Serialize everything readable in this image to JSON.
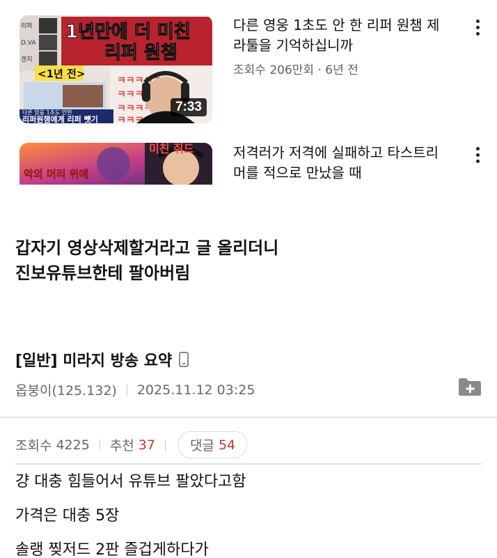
{
  "videos": [
    {
      "title": "다른 영웅 1초도 안 한 리퍼 원챔 제라툴을 기억하십니까",
      "meta": "조회수 206만회 · 6년 전",
      "duration": "7:33",
      "thumb_text_1": "1년만에 더 미친",
      "thumb_text_2": "리퍼 원챔",
      "thumb_text_3": "<1년 전>",
      "thumb_text_4": "다른 영웅 1초도 안한",
      "thumb_text_5": "리퍼원챔에게 리퍼 뺏기",
      "thumb_side_1": "리퍼",
      "thumb_side_2": "D.VA",
      "thumb_side_3": "겐지"
    },
    {
      "title": "저격러가 저격에 실패하고 타스트리머를 적으로 만났을 때",
      "thumb_text_1": "미친 쥐드",
      "thumb_text_2": "악의 머리 위에"
    }
  ],
  "headline": {
    "line1": "갑자기 영상삭제할거라고 글 올리더니",
    "line2": "진보유튜브한테 팔아버림"
  },
  "post": {
    "title": "[일반] 미라지 방송 요약",
    "author": "옵붕이(125.132)",
    "datetime": "2025.11.12 03:25",
    "views_label": "조회수",
    "views": "4225",
    "recommend_label": "추천",
    "recommend": "37",
    "comments_label": "댓글",
    "comments": "54",
    "body": [
      "걍 대충 힘들어서 유튜브 팔았다고함",
      "가격은 대충 5장",
      "솔랭 찢저드 2판 즐겁게하다가"
    ]
  },
  "icons": {
    "more": "kebab-icon",
    "mobile": "mobile-icon",
    "folder": "folder-plus-icon"
  },
  "colors": {
    "accent_red": "#c0392b",
    "meta_gray": "#666666"
  }
}
